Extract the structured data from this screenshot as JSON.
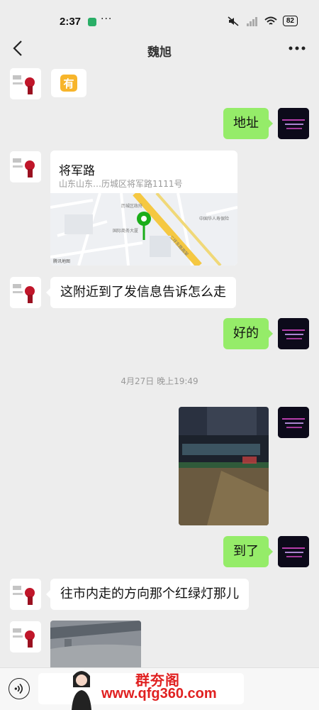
{
  "status_bar": {
    "time": "2:37",
    "battery": "82"
  },
  "header": {
    "title": "魏旭"
  },
  "messages": {
    "sticker_char": "有",
    "address_label": "地址",
    "location_name": "将军路",
    "location_address": "山东山东…历城区将军路1111号",
    "map_labels": {
      "place1": "中国华人寿保险",
      "place2": "历城区政府",
      "place3": "二环东路高架",
      "place4": "国际商务大厦",
      "place5": "腾讯地图"
    },
    "msg_nearby": "这附近到了发信息告诉怎么走",
    "msg_ok": "好的",
    "timestamp": "4月27日 晚上19:49",
    "msg_arrived": "到了",
    "msg_direction": "往市内走的方向那个红绿灯那儿"
  },
  "watermark": {
    "brand": "群夯阁",
    "url": "www.qfg360.com"
  },
  "colors": {
    "background": "#ededed",
    "bubble_green": "#95ec69",
    "bubble_white": "#ffffff",
    "pin_green": "#1aad19"
  }
}
